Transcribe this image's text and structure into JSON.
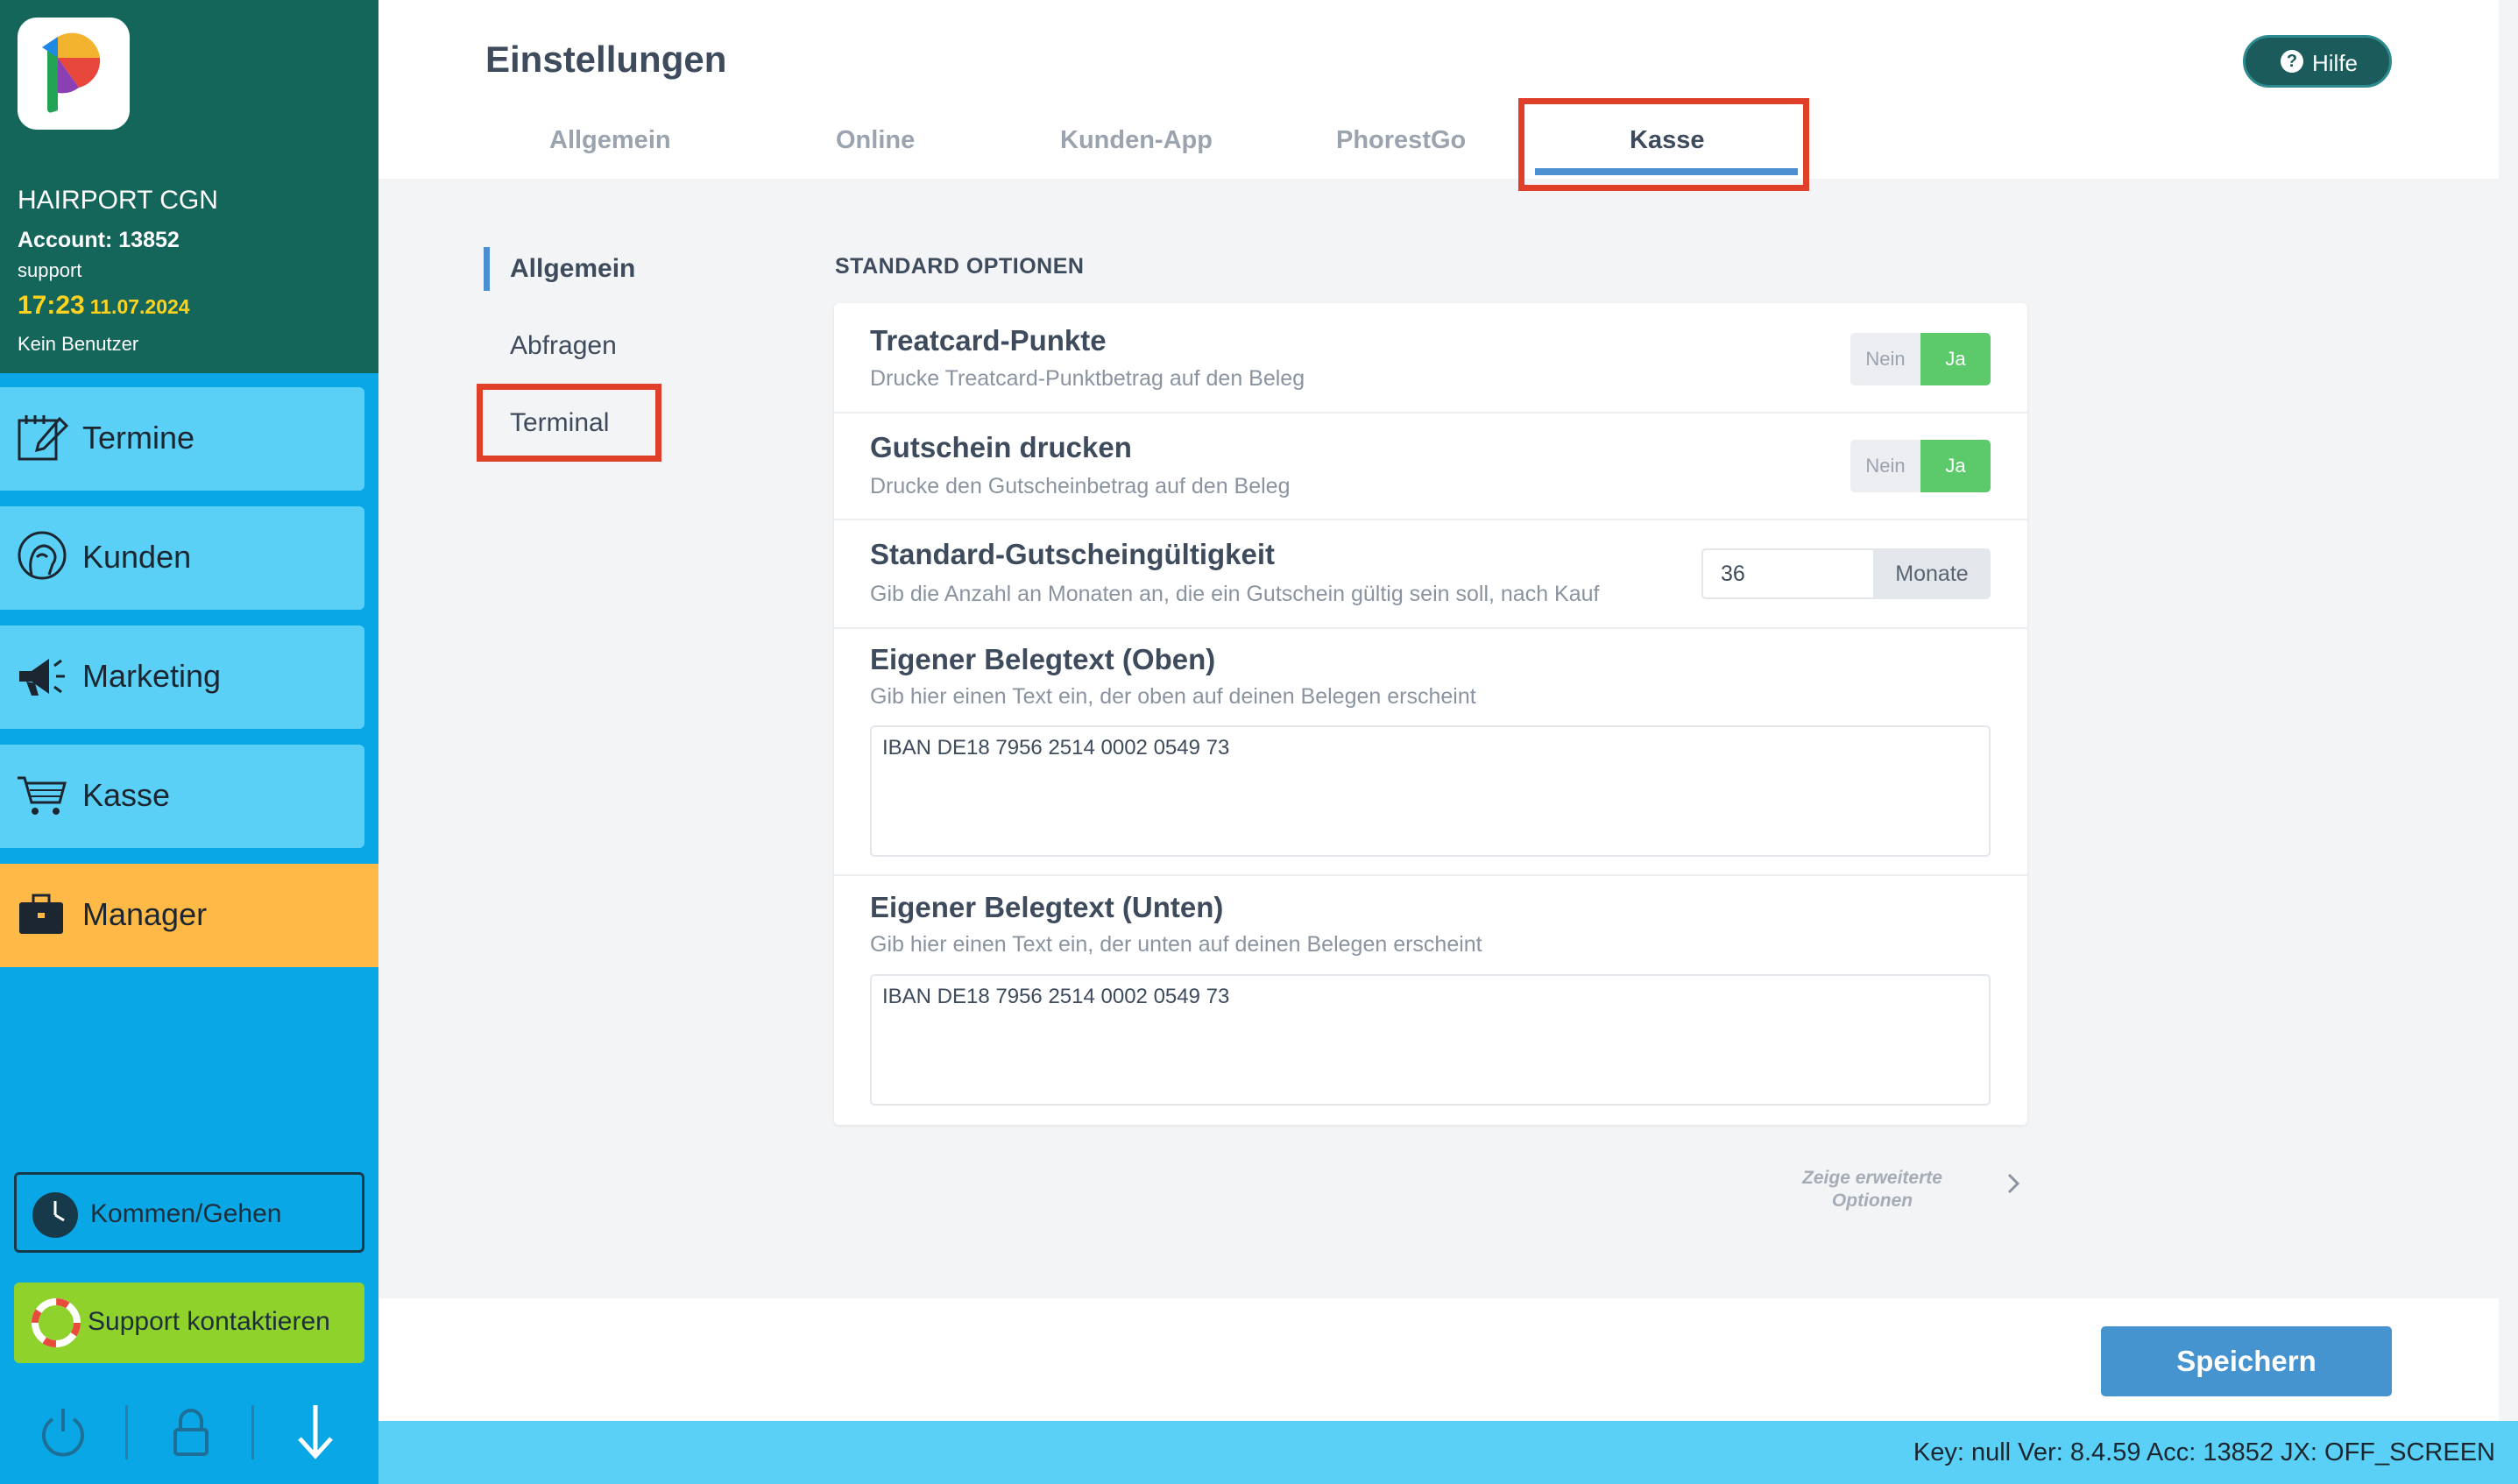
{
  "sidebar": {
    "company": "HAIRPORT CGN",
    "account": "Account: 13852",
    "user": "support",
    "time": "17:23",
    "date": "11.07.2024",
    "no_user": "Kein Benutzer",
    "nav": [
      {
        "label": "Termine",
        "icon": "calendar-edit-icon"
      },
      {
        "label": "Kunden",
        "icon": "customer-head-icon"
      },
      {
        "label": "Marketing",
        "icon": "megaphone-icon"
      },
      {
        "label": "Kasse",
        "icon": "cart-icon"
      },
      {
        "label": "Manager",
        "icon": "briefcase-icon"
      }
    ],
    "kommen_gehen": "Kommen/Gehen",
    "support": "Support kontaktieren"
  },
  "header": {
    "title": "Einstellungen",
    "help": "Hilfe",
    "tabs": [
      "Allgemein",
      "Online",
      "Kunden-App",
      "PhorestGo",
      "Kasse"
    ],
    "active_tab": "Kasse"
  },
  "subnav": {
    "items": [
      "Allgemein",
      "Abfragen",
      "Terminal"
    ],
    "active": "Allgemein"
  },
  "section": {
    "title": "STANDARD OPTIONEN",
    "options": [
      {
        "title": "Treatcard-Punkte",
        "desc": "Drucke Treatcard-Punktbetrag auf den Beleg",
        "no": "Nein",
        "yes": "Ja",
        "value": "Ja"
      },
      {
        "title": "Gutschein drucken",
        "desc": "Drucke den Gutscheinbetrag auf den Beleg",
        "no": "Nein",
        "yes": "Ja",
        "value": "Ja"
      },
      {
        "title": "Standard-Gutscheingültigkeit",
        "desc": "Gib die Anzahl an Monaten an, die ein Gutschein gültig sein soll, nach Kauf",
        "value": "36",
        "unit": "Monate"
      },
      {
        "title": "Eigener Belegtext (Oben)",
        "desc": "Gib hier einen Text ein, der oben auf deinen Belegen erscheint",
        "value": "IBAN DE18 7956 2514 0002 0549 73"
      },
      {
        "title": "Eigener Belegtext (Unten)",
        "desc": "Gib hier einen Text ein, der unten auf deinen Belegen erscheint",
        "value": "IBAN DE18 7956 2514 0002 0549 73"
      }
    ],
    "more_options": "Zeige erweiterte Optionen"
  },
  "footer": {
    "save": "Speichern"
  },
  "status": {
    "text": "Key: null Ver: 8.4.59 Acc: 13852  JX: OFF_SCREEN"
  },
  "colors": {
    "sidebar_top": "#14655a",
    "sidebar": "#0aa7e6",
    "nav_button": "#5bd0f7",
    "manager": "#ffb946",
    "support": "#8fd22c",
    "toggle_yes": "#5cc96b",
    "primary": "#4593cf",
    "highlight": "#e0402a"
  }
}
